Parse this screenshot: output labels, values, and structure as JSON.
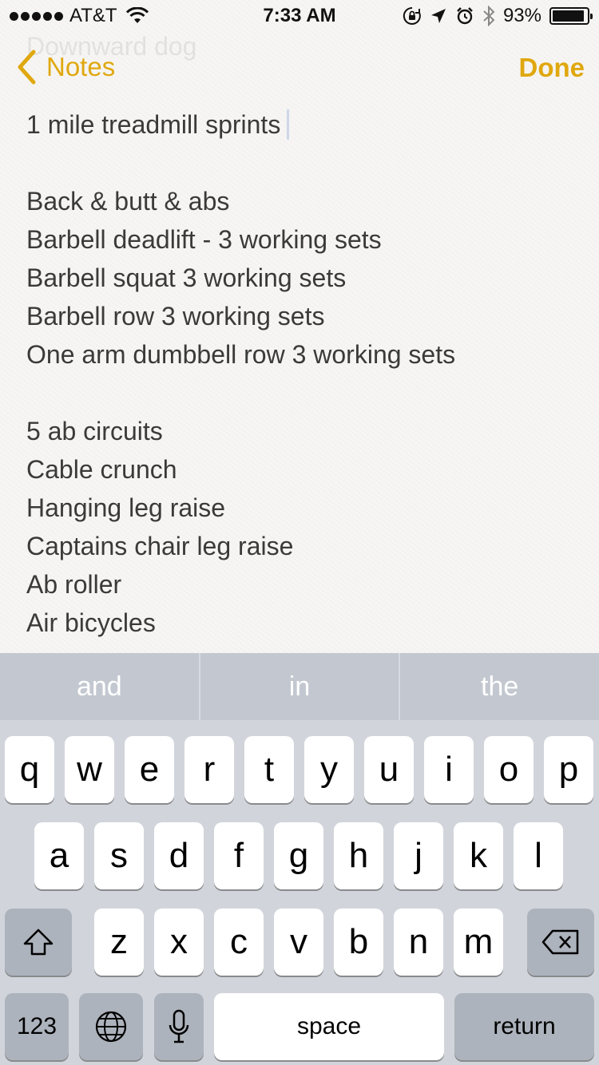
{
  "status_bar": {
    "carrier": "AT&T",
    "time": "7:33 AM",
    "battery_percent": "93%",
    "battery_level": 0.93,
    "signal_bars": 5,
    "icons": [
      "wifi-icon",
      "orientation-lock-icon",
      "location-arrow-icon",
      "alarm-icon",
      "bluetooth-icon",
      "battery-icon"
    ]
  },
  "ghost_text": "Downward dog",
  "nav": {
    "back_label": "Notes",
    "done_label": "Done",
    "accent_color": "#e0a80f"
  },
  "note": {
    "lines": [
      "1 mile treadmill sprints",
      "",
      "Back & butt & abs",
      "Barbell deadlift - 3 working sets",
      "Barbell squat 3 working sets",
      "Barbell row 3 working sets",
      "One arm dumbbell row 3 working sets",
      "",
      "5 ab circuits",
      "Cable crunch",
      "Hanging leg raise",
      "Captains chair leg raise",
      "Ab roller",
      "Air bicycles"
    ]
  },
  "keyboard": {
    "suggestions": [
      "and",
      "in",
      "the"
    ],
    "row1": [
      "q",
      "w",
      "e",
      "r",
      "t",
      "y",
      "u",
      "i",
      "o",
      "p"
    ],
    "row2": [
      "a",
      "s",
      "d",
      "f",
      "g",
      "h",
      "j",
      "k",
      "l"
    ],
    "row3": [
      "z",
      "x",
      "c",
      "v",
      "b",
      "n",
      "m"
    ],
    "numbers_label": "123",
    "space_label": "space",
    "return_label": "return"
  }
}
